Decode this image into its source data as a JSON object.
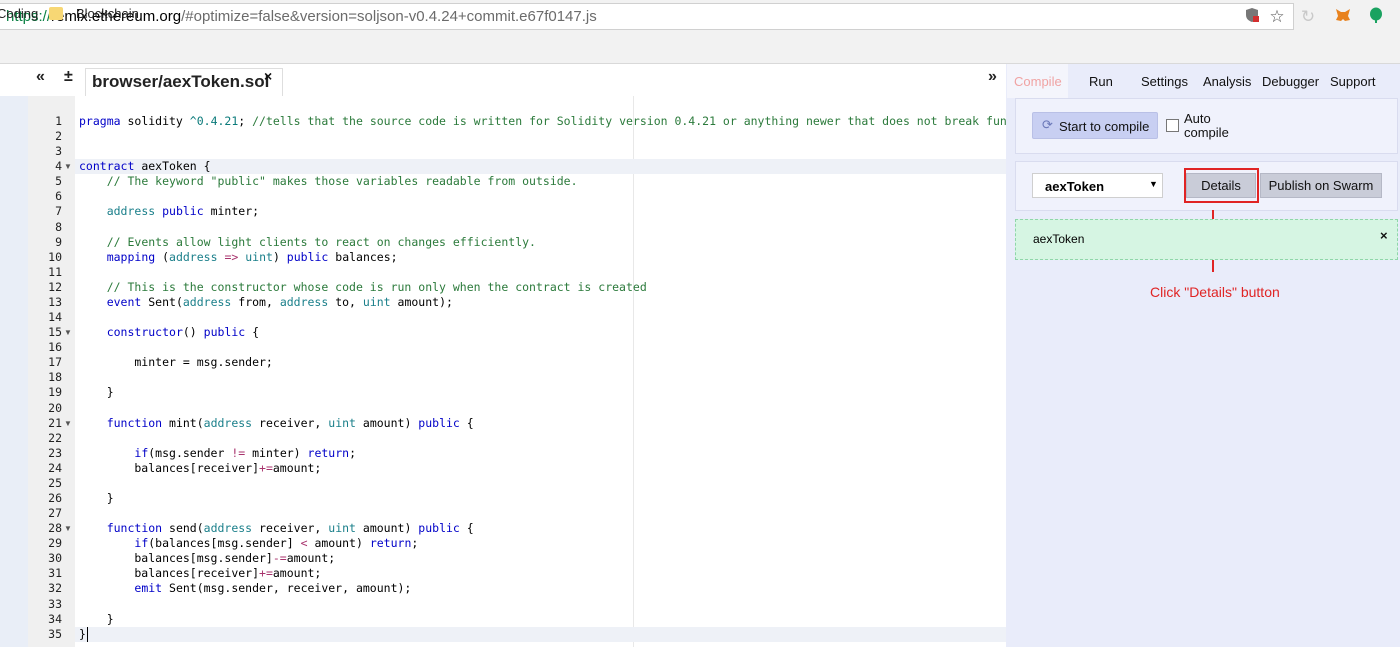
{
  "browser": {
    "url_protocol": "https://",
    "url_host": "remix.ethereum.org",
    "url_rest": "/#optimize=false&version=soljson-v0.4.24+commit.e67f0147.js",
    "bookmarks": [
      "Coding",
      "Blockchain"
    ]
  },
  "editor": {
    "tab_file": "browser/aexToken.sol",
    "tab_close": "×",
    "collapse_left": "«",
    "add_file": "±",
    "expand_right": "»",
    "lines": [
      "pragma solidity ^0.4.21; //tells that the source code is written for Solidity version 0.4.21 or anything newer that does not break fun",
      "",
      "",
      "contract aexToken {",
      "    // The keyword \"public\" makes those variables readable from outside.",
      "",
      "    address public minter;",
      "",
      "    // Events allow light clients to react on changes efficiently.",
      "    mapping (address => uint) public balances;",
      "",
      "    // This is the constructor whose code is run only when the contract is created",
      "    event Sent(address from, address to, uint amount);",
      "",
      "    constructor() public {",
      "",
      "        minter = msg.sender;",
      "",
      "    }",
      "",
      "    function mint(address receiver, uint amount) public {",
      "",
      "        if(msg.sender != minter) return;",
      "        balances[receiver]+=amount;",
      "",
      "    }",
      "",
      "    function send(address receiver, uint amount) public {",
      "        if(balances[msg.sender] < amount) return;",
      "        balances[msg.sender]-=amount;",
      "        balances[receiver]+=amount;",
      "        emit Sent(msg.sender, receiver, amount);",
      "",
      "    }",
      "}"
    ],
    "fold_lines": [
      4,
      15,
      21,
      28
    ]
  },
  "panel": {
    "tabs": [
      "Compile",
      "Run",
      "Settings",
      "Analysis",
      "Debugger",
      "Support"
    ],
    "start_compile": "Start to compile",
    "auto_compile": "Auto compile",
    "contract_selected": "aexToken",
    "details": "Details",
    "publish": "Publish on Swarm",
    "success_contract": "aexToken",
    "success_close": "×",
    "annotation": "Click \"Details\" button"
  }
}
